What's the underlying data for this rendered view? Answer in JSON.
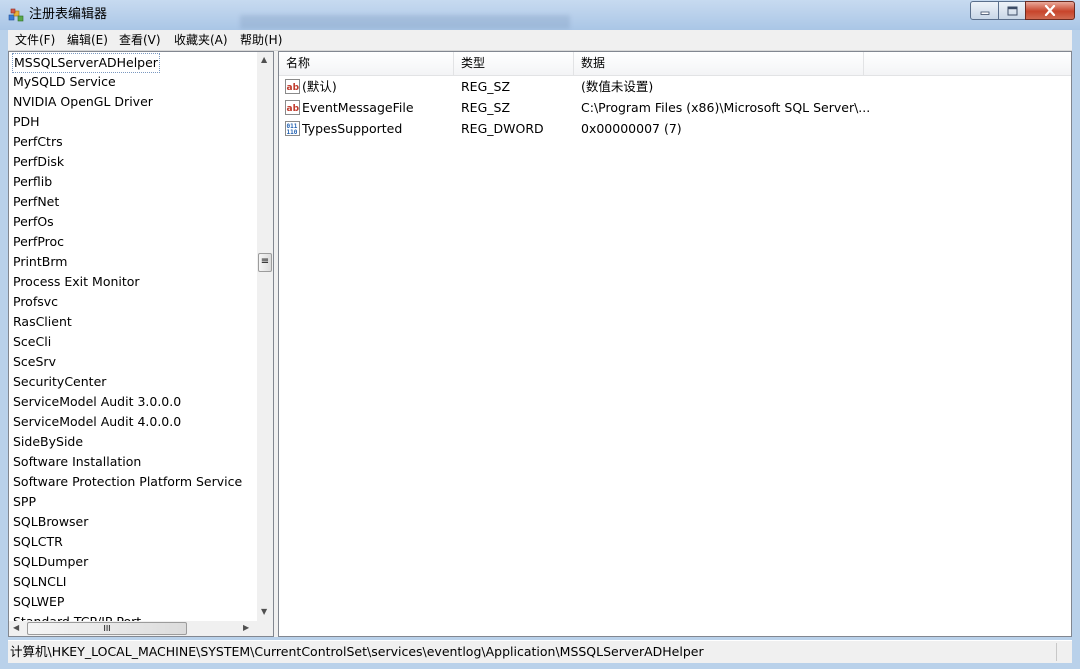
{
  "window": {
    "title": "注册表编辑器"
  },
  "menu": [
    "文件(F)",
    "编辑(E)",
    "查看(V)",
    "收藏夹(A)",
    "帮助(H)"
  ],
  "tree": {
    "items": [
      "MSSQLServerADHelper",
      "MySQLD Service",
      "NVIDIA OpenGL Driver",
      "PDH",
      "PerfCtrs",
      "PerfDisk",
      "Perflib",
      "PerfNet",
      "PerfOs",
      "PerfProc",
      "PrintBrm",
      "Process Exit Monitor",
      "Profsvc",
      "RasClient",
      "SceCli",
      "SceSrv",
      "SecurityCenter",
      "ServiceModel Audit 3.0.0.0",
      "ServiceModel Audit 4.0.0.0",
      "SideBySide",
      "Software Installation",
      "Software Protection Platform Service",
      "SPP",
      "SQLBrowser",
      "SQLCTR",
      "SQLDumper",
      "SQLNCLI",
      "SQLWEP",
      "Standard TCP/IP Port"
    ],
    "selected_index": 0,
    "hscroll_thumb_label": "III",
    "vscroll_thumb_label": "≡"
  },
  "list": {
    "columns": [
      "名称",
      "类型",
      "数据"
    ],
    "rows": [
      {
        "icon": "string-value-icon",
        "name": "(默认)",
        "type": "REG_SZ",
        "data": "(数值未设置)"
      },
      {
        "icon": "string-value-icon",
        "name": "EventMessageFile",
        "type": "REG_SZ",
        "data": "C:\\Program Files (x86)\\Microsoft SQL Server\\..."
      },
      {
        "icon": "binary-value-icon",
        "name": "TypesSupported",
        "type": "REG_DWORD",
        "data": "0x00000007 (7)"
      }
    ]
  },
  "status": {
    "path": "计算机\\HKEY_LOCAL_MACHINE\\SYSTEM\\CurrentControlSet\\services\\eventlog\\Application\\MSSQLServerADHelper"
  },
  "colors": {
    "titlebar": "#b9d1ea",
    "close_button": "#c7442b",
    "selection_border": "#7a98c0"
  }
}
